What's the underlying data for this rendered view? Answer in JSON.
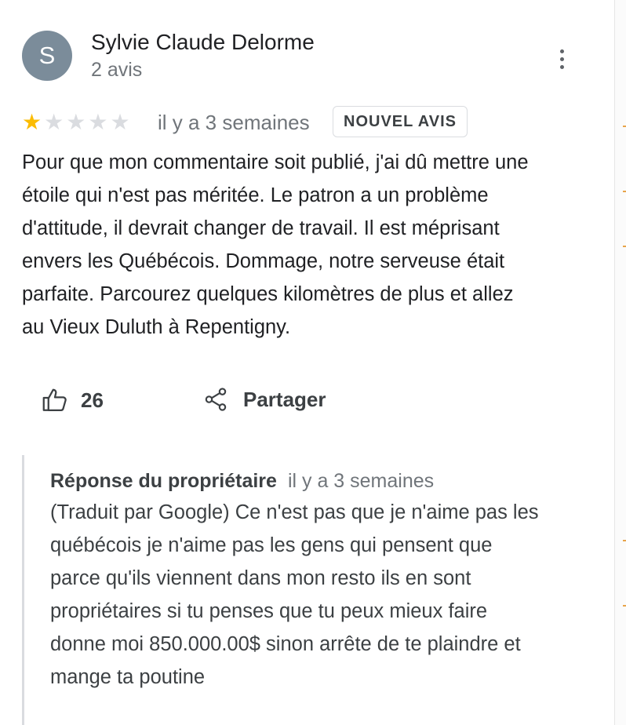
{
  "review": {
    "author": {
      "initial": "S",
      "avatar_color": "#7b8c9a",
      "name": "Sylvie Claude Delorme",
      "review_count": "2 avis"
    },
    "rating": 1,
    "rating_max": 5,
    "star_color": "#fbbc04",
    "time": "il y a 3 semaines",
    "badge": "NOUVEL AVIS",
    "text_lines": [
      "Pour que mon commentaire soit publié, j'ai dû mettre une",
      "étoile qui n'est pas méritée.  Le patron a un problème",
      "d'attitude, il devrait changer de travail.  Il est  méprisant",
      "envers les Québécois.  Dommage, notre serveuse était",
      "parfaite.  Parcourez quelques kilomètres de plus et allez",
      "au Vieux Duluth à Repentigny."
    ],
    "actions": {
      "like_icon": "thumb-up-icon",
      "like_count": "26",
      "share_icon": "share-icon",
      "share_label": "Partager"
    }
  },
  "owner_response": {
    "title": "Réponse du propriétaire",
    "time": "il y a 3 semaines",
    "text_lines": [
      "(Traduit par Google) Ce n'est pas que je n'aime pas les",
      "québécois je n'aime pas les gens qui pensent que",
      "parce qu'ils viennent dans mon resto ils en sont",
      "propriétaires si tu penses que tu peux mieux faire",
      "donne moi 850.000.00$ sinon arrête de te plaindre et",
      "mange ta poutine"
    ]
  }
}
